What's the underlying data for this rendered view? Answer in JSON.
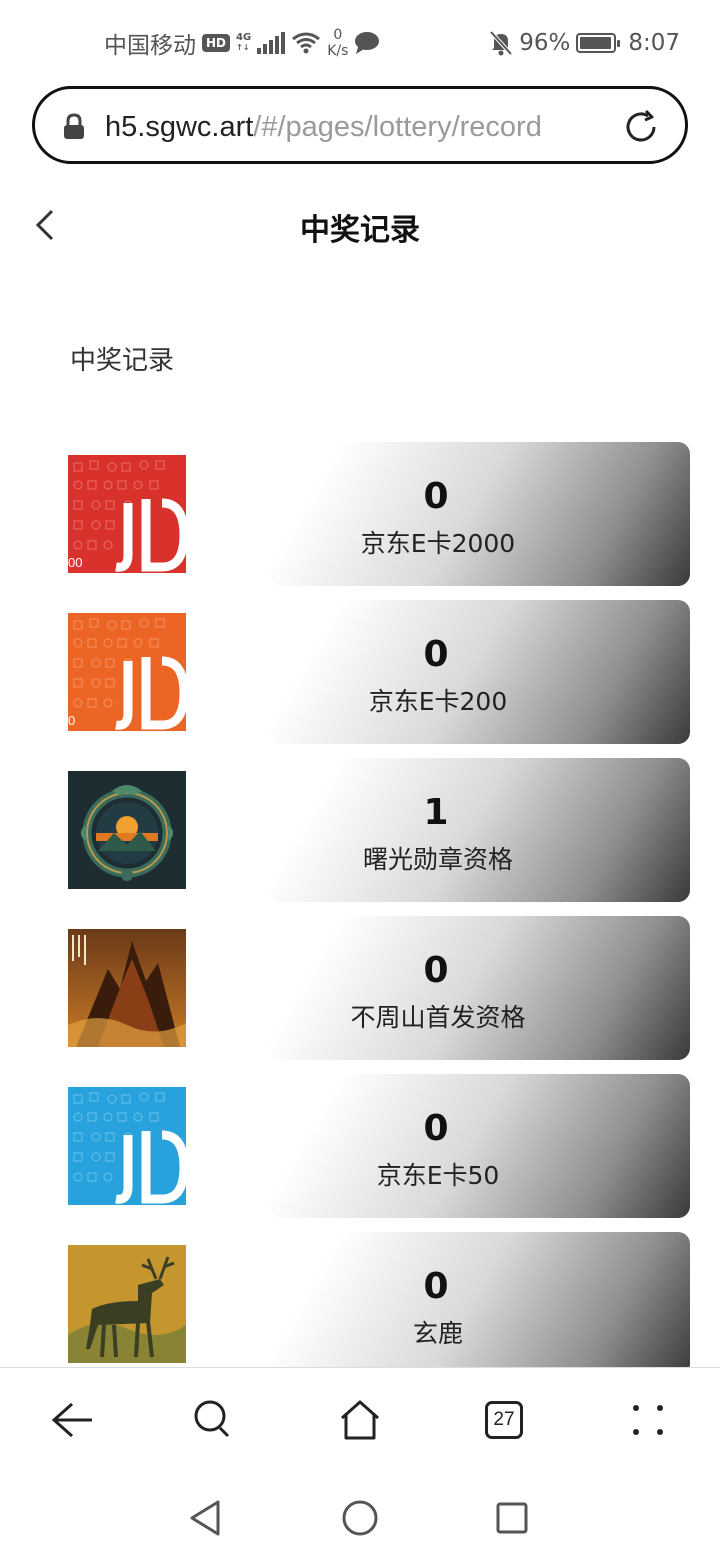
{
  "status": {
    "carrier": "中国移动",
    "hd": "HD",
    "net_top": "4G",
    "net_bottom": "↑↓",
    "speed_value": "0",
    "speed_unit": "K/s",
    "battery": "96%",
    "battery_level": 0.96,
    "time": "8:07"
  },
  "browser": {
    "url_domain": "h5.sgwc.art",
    "url_path": "/#/pages/lottery/record",
    "tab_count": "27"
  },
  "page": {
    "title": "中奖记录",
    "section_title": "中奖记录"
  },
  "records": [
    {
      "count": "0",
      "name": "京东E卡2000",
      "thumb": "jd-card-red-icon",
      "thumb_text": "00",
      "color": "#d9322c"
    },
    {
      "count": "0",
      "name": "京东E卡200",
      "thumb": "jd-card-orange-icon",
      "thumb_text": "0",
      "color": "#ec6525"
    },
    {
      "count": "1",
      "name": "曙光勋章资格",
      "thumb": "dawn-medal-art",
      "color": "#1b2a2f"
    },
    {
      "count": "0",
      "name": "不周山首发资格",
      "thumb": "buzhou-mountain-art",
      "color": "#7a3c14"
    },
    {
      "count": "0",
      "name": "京东E卡50",
      "thumb": "jd-card-blue-icon",
      "color": "#27a2dc"
    },
    {
      "count": "0",
      "name": "玄鹿",
      "thumb": "deer-art",
      "color": "#b8892c"
    }
  ]
}
